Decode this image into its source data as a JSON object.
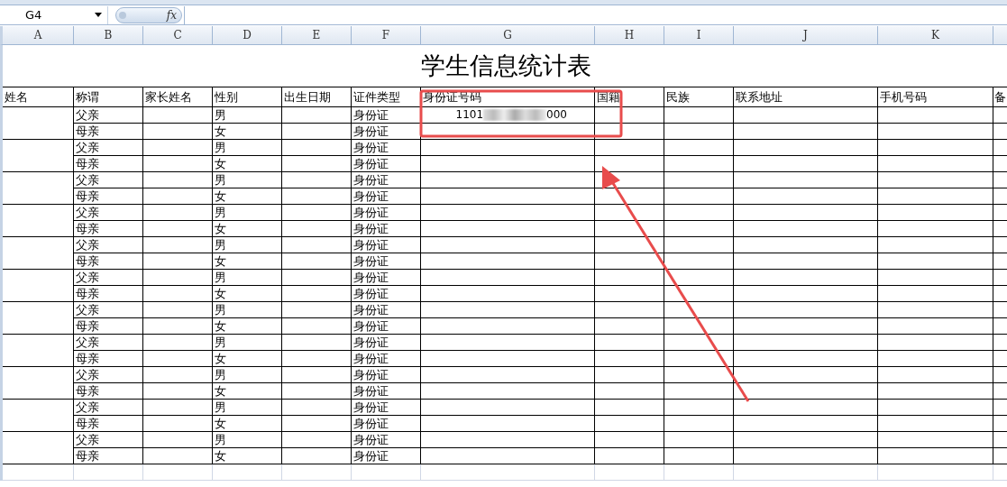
{
  "formula_bar": {
    "name_box": "G4",
    "fx": "fx"
  },
  "columns": [
    "A",
    "B",
    "C",
    "D",
    "E",
    "F",
    "G",
    "H",
    "I",
    "J",
    "K"
  ],
  "title": "学生信息统计表",
  "headers": [
    "姓名",
    "称谓",
    "家长姓名",
    "性别",
    "出生日期",
    "证件类型",
    "身份证号码",
    "国籍",
    "民族",
    "联系地址",
    "手机号码",
    "备"
  ],
  "id_number": {
    "start": "1101",
    "end": "000"
  },
  "rows": [
    {
      "relation": "父亲",
      "gender": "男",
      "id_type": "身份证"
    },
    {
      "relation": "母亲",
      "gender": "女",
      "id_type": "身份证"
    },
    {
      "relation": "父亲",
      "gender": "男",
      "id_type": "身份证"
    },
    {
      "relation": "母亲",
      "gender": "女",
      "id_type": "身份证"
    },
    {
      "relation": "父亲",
      "gender": "男",
      "id_type": "身份证"
    },
    {
      "relation": "母亲",
      "gender": "女",
      "id_type": "身份证"
    },
    {
      "relation": "父亲",
      "gender": "男",
      "id_type": "身份证"
    },
    {
      "relation": "母亲",
      "gender": "女",
      "id_type": "身份证"
    },
    {
      "relation": "父亲",
      "gender": "男",
      "id_type": "身份证"
    },
    {
      "relation": "母亲",
      "gender": "女",
      "id_type": "身份证"
    },
    {
      "relation": "父亲",
      "gender": "男",
      "id_type": "身份证"
    },
    {
      "relation": "母亲",
      "gender": "女",
      "id_type": "身份证"
    },
    {
      "relation": "父亲",
      "gender": "男",
      "id_type": "身份证"
    },
    {
      "relation": "母亲",
      "gender": "女",
      "id_type": "身份证"
    },
    {
      "relation": "父亲",
      "gender": "男",
      "id_type": "身份证"
    },
    {
      "relation": "母亲",
      "gender": "女",
      "id_type": "身份证"
    },
    {
      "relation": "父亲",
      "gender": "男",
      "id_type": "身份证"
    },
    {
      "relation": "母亲",
      "gender": "女",
      "id_type": "身份证"
    },
    {
      "relation": "父亲",
      "gender": "男",
      "id_type": "身份证"
    },
    {
      "relation": "母亲",
      "gender": "女",
      "id_type": "身份证"
    },
    {
      "relation": "父亲",
      "gender": "男",
      "id_type": "身份证"
    },
    {
      "relation": "母亲",
      "gender": "女",
      "id_type": "身份证"
    }
  ]
}
